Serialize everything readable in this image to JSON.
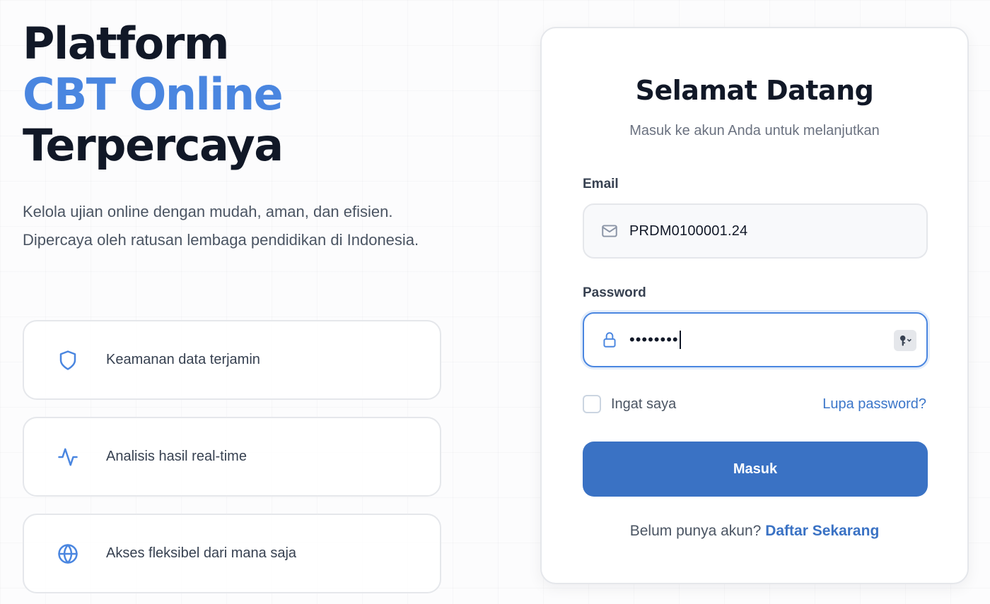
{
  "hero": {
    "title_line1": "Platform",
    "title_accent": "CBT Online",
    "title_line3": "Terpercaya",
    "description": "Kelola ujian online dengan mudah, aman, dan efisien. Dipercaya oleh ratusan lembaga pendidikan di Indonesia."
  },
  "features": [
    {
      "icon": "shield-icon",
      "label": "Keamanan data terjamin"
    },
    {
      "icon": "activity-icon",
      "label": "Analisis hasil real-time"
    },
    {
      "icon": "globe-icon",
      "label": "Akses fleksibel dari mana saja"
    }
  ],
  "login": {
    "title": "Selamat Datang",
    "subtitle": "Masuk ke akun Anda untuk melanjutkan",
    "email_label": "Email",
    "email_value": "PRDM0100001.24",
    "password_label": "Password",
    "password_mask": "••••••••",
    "remember_label": "Ingat saya",
    "forgot_link": "Lupa password?",
    "submit_label": "Masuk",
    "signup_prompt": "Belum punya akun?",
    "signup_link": "Daftar Sekarang"
  },
  "colors": {
    "accent": "#4a86e0",
    "button": "#3a72c4",
    "text_dark": "#111827"
  }
}
